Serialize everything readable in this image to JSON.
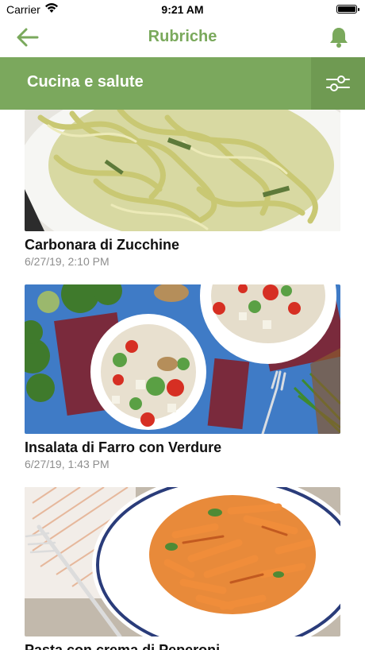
{
  "status": {
    "carrier": "Carrier",
    "time": "9:21 AM"
  },
  "nav": {
    "title": "Rubriche",
    "back_icon": "arrow-left-icon",
    "bell_icon": "bell-icon"
  },
  "section": {
    "label": "Cucina e salute",
    "filter_icon": "sliders-icon"
  },
  "colors": {
    "accent": "#7aa95c",
    "header_bar": "#7ba85d",
    "filter_bg": "#6f9a52",
    "date_gray": "#8e8e8e"
  },
  "articles": [
    {
      "title": "Carbonara di Zucchine",
      "date": "6/27/19, 2:10 PM"
    },
    {
      "title": "Insalata di Farro con Verdure",
      "date": "6/27/19, 1:43 PM"
    },
    {
      "title": "Pasta con crema di Peperoni",
      "date": ""
    }
  ]
}
